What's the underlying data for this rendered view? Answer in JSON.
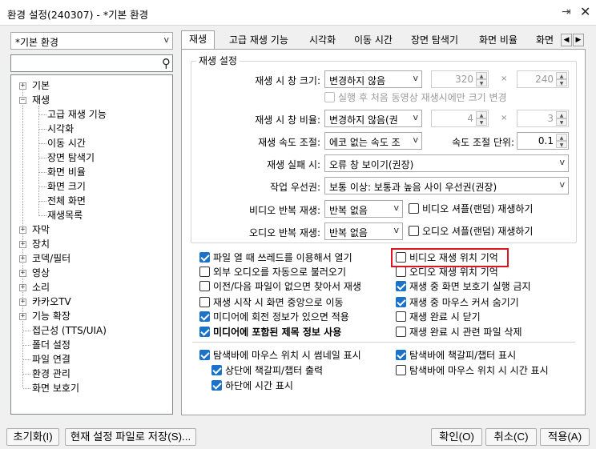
{
  "window": {
    "title": "환경 설정(240307) - *기본 환경",
    "pin_glyph": "⇥",
    "close_glyph": "✕"
  },
  "profile_select": {
    "value": "*기본 환경"
  },
  "search": {
    "value": "",
    "placeholder": ""
  },
  "tree": {
    "items": [
      {
        "label": "기본",
        "expand": "+"
      },
      {
        "label": "재생",
        "expand": "−"
      },
      {
        "label": "고급 재생 기능"
      },
      {
        "label": "시각화"
      },
      {
        "label": "이동 시간"
      },
      {
        "label": "장면 탐색기"
      },
      {
        "label": "화면 비율"
      },
      {
        "label": "화면 크기"
      },
      {
        "label": "전체 화면"
      },
      {
        "label": "재생목록"
      },
      {
        "label": "자막",
        "expand": "+"
      },
      {
        "label": "장치",
        "expand": "+"
      },
      {
        "label": "코덱/필터",
        "expand": "+"
      },
      {
        "label": "영상",
        "expand": "+"
      },
      {
        "label": "소리",
        "expand": "+"
      },
      {
        "label": "카카오TV",
        "expand": "+"
      },
      {
        "label": "기능 확장",
        "expand": "+"
      },
      {
        "label": "접근성 (TTS/UIA)"
      },
      {
        "label": "폴더 설정"
      },
      {
        "label": "파일 연결"
      },
      {
        "label": "환경 관리"
      },
      {
        "label": "화면 보호기"
      }
    ]
  },
  "tabs": [
    "재생",
    "고급 재생 기능",
    "시각화",
    "이동 시간",
    "장면 탐색기",
    "화면 비율",
    "화면"
  ],
  "tab_scroll": {
    "left": "◀",
    "right": "▶"
  },
  "playback": {
    "group_title": "재생 설정",
    "window_size": {
      "label": "재생 시 창 크기:",
      "value": "변경하지 않음",
      "width": "320",
      "height": "240"
    },
    "first_only": "실행 후 처음 동영상 재생시에만 크기 변경",
    "window_ratio": {
      "label": "재생 시 창 비율:",
      "value": "변경하지 않음(권",
      "w": "4",
      "h": "3"
    },
    "speed": {
      "label": "재생 속도 조절:",
      "value": "에코 없는 속도 조",
      "unit_label": "속도 조절 단위:",
      "unit_value": "0.1"
    },
    "fail": {
      "label": "재생 실패 시:",
      "value": "오류 창 보이기(권장)"
    },
    "priority": {
      "label": "작업 우선권:",
      "value": "보통 이상: 보통과 높음 사이 우선권(권장)"
    },
    "video_repeat": {
      "label": "비디오 반복 재생:",
      "value": "반복 없음",
      "shuffle": "비디오 셔플(랜덤) 재생하기"
    },
    "audio_repeat": {
      "label": "오디오 반복 재생:",
      "value": "반복 없음",
      "shuffle": "오디오 셔플(랜덤) 재생하기"
    },
    "times_glyph": "×"
  },
  "options_left": [
    {
      "label": "파일 열 때 쓰레드를 이용해서 열기",
      "checked": true
    },
    {
      "label": "외부 오디오를 자동으로 불러오기",
      "checked": false
    },
    {
      "label": "이전/다음 파일이 없으면 찾아서 재생",
      "checked": false
    },
    {
      "label": "재생 시작 시 화면 중앙으로 이동",
      "checked": false
    },
    {
      "label": "미디어에 회전 정보가 있으면 적용",
      "checked": true
    },
    {
      "label": "미디어에 포함된 제목 정보 사용",
      "checked": true
    }
  ],
  "options_right": [
    {
      "label": "비디오 재생 위치 기억",
      "checked": false
    },
    {
      "label": "오디오 재생 위치 기억",
      "checked": false
    },
    {
      "label": "재생 중 화면 보호기 실행 금지",
      "checked": true
    },
    {
      "label": "재생 중 마우스 커서 숨기기",
      "checked": true
    },
    {
      "label": "재생 완료 시 닫기",
      "checked": false
    },
    {
      "label": "재생 완료 시 관련 파일 삭제",
      "checked": false
    }
  ],
  "seekbar_left": [
    {
      "label": "탐색바에 마우스 위치 시 썸네일 표시",
      "checked": true
    },
    {
      "label": "상단에 책갈피/챕터 출력",
      "checked": true
    },
    {
      "label": "하단에 시간 표시",
      "checked": true
    }
  ],
  "seekbar_right": [
    {
      "label": "탐색바에 책갈피/챕터 표시",
      "checked": true
    },
    {
      "label": "탐색바에 마우스 위치 시 시간 표시",
      "checked": false
    }
  ],
  "buttons": {
    "reset": "초기화(I)",
    "save_current": "현재 설정 파일로 저장(S)...",
    "ok": "확인(O)",
    "cancel": "취소(C)",
    "apply": "적용(A)"
  },
  "colors": {
    "highlight": "#e0141e",
    "check": "#1a73c9"
  }
}
